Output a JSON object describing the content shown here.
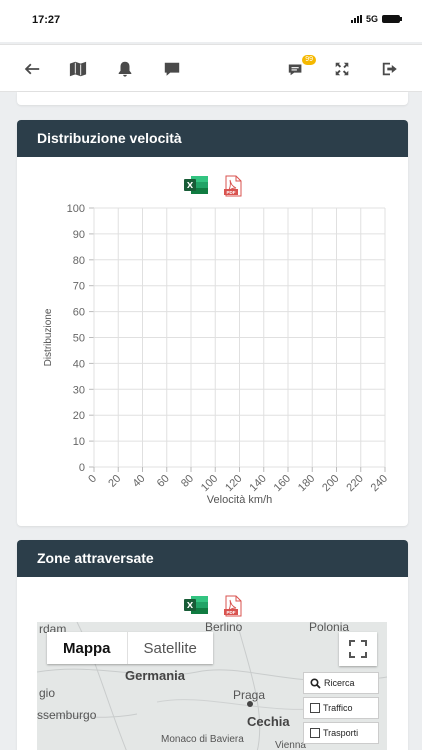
{
  "status": {
    "time": "17:27",
    "network": "5G"
  },
  "toolbar": {
    "icons": [
      "back-arrow-icon",
      "map-icon",
      "bell-icon",
      "chat-icon",
      "messages-icon",
      "fullscreen-icon",
      "logout-icon"
    ],
    "badge_count": "99"
  },
  "speed_card": {
    "title": "Distribuzione velocità",
    "export_excel_icon": "excel-icon",
    "export_pdf_icon": "pdf-icon"
  },
  "chart_data": {
    "type": "bar",
    "title": "",
    "xlabel": "Velocità km/h",
    "ylabel": "Distribuzione",
    "x_ticks": [
      "0",
      "20",
      "40",
      "60",
      "80",
      "100",
      "120",
      "140",
      "160",
      "180",
      "200",
      "220",
      "240"
    ],
    "y_ticks": [
      "0",
      "10",
      "20",
      "30",
      "40",
      "50",
      "60",
      "70",
      "80",
      "90",
      "100"
    ],
    "xlim": [
      0,
      240
    ],
    "ylim": [
      0,
      100
    ],
    "series": [],
    "grid": true
  },
  "zones_card": {
    "title": "Zone attraversate",
    "map": {
      "tab_map": "Mappa",
      "tab_satellite": "Satellite",
      "labels": [
        "Germania",
        "Praga",
        "Cechia",
        "ssemburgo",
        "gio",
        "Monaco di Baviera",
        "Vienna",
        "Berlino",
        "Polonia",
        "rdam"
      ],
      "controls": {
        "search": "Ricerca",
        "traffic": "Traffico",
        "transport": "Trasporti"
      }
    }
  },
  "colors": {
    "header": "#2c3e4a",
    "grid": "#e0e0e0",
    "badge": "#f5b800",
    "excel": "#1e7145",
    "pdf": "#d9534f"
  }
}
